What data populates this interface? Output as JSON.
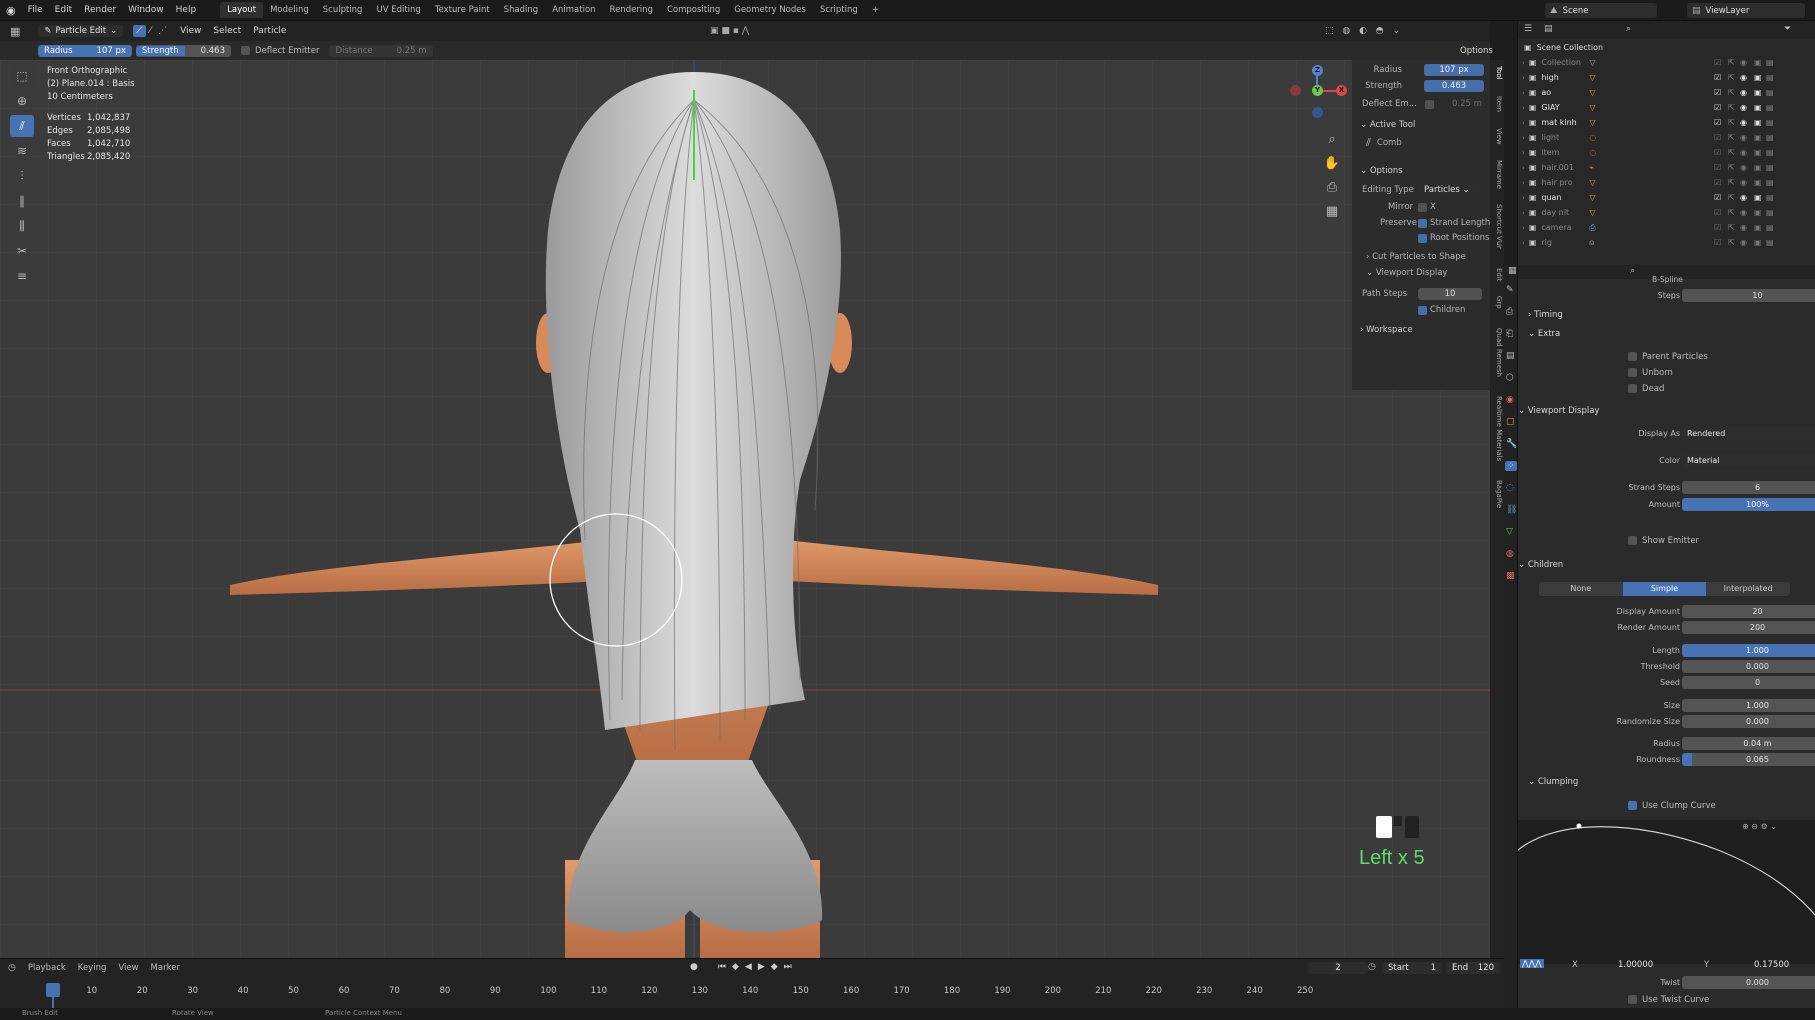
{
  "menus": [
    "File",
    "Edit",
    "Render",
    "Window",
    "Help"
  ],
  "workspaces": [
    "Layout",
    "Modeling",
    "Sculpting",
    "UV Editing",
    "Texture Paint",
    "Shading",
    "Animation",
    "Rendering",
    "Compositing",
    "Geometry Nodes",
    "Scripting"
  ],
  "active_workspace": "Layout",
  "scene_name": "Scene",
  "view_layer": "ViewLayer",
  "header": {
    "mode": "Particle Edit",
    "view": "View",
    "select": "Select",
    "particle": "Particle"
  },
  "tool_header": {
    "radius_label": "Radius",
    "radius_value": "107 px",
    "strength_label": "Strength",
    "strength_value": "0.463",
    "deflect_label": "Deflect Emitter",
    "distance_label": "Distance",
    "distance_value": "0.25 m",
    "options_label": "Options"
  },
  "viewport_info": {
    "view": "Front Orthographic",
    "object": "(2) Plane.014 : Basis",
    "scale": "10 Centimeters",
    "stats": [
      {
        "label": "Vertices",
        "value": "1,042,837"
      },
      {
        "label": "Edges",
        "value": "2,085,498"
      },
      {
        "label": "Faces",
        "value": "1,042,710"
      },
      {
        "label": "Triangles",
        "value": "2,085,420"
      }
    ]
  },
  "key_overlay": "Left x 5",
  "npanel": {
    "radius_label": "Radius",
    "radius_value": "107 px",
    "strength_label": "Strength",
    "strength_value": "0.463",
    "deflect_label": "Deflect Em...",
    "deflect_value": "0.25 m",
    "active_tool": "Active Tool",
    "tool_name": "Comb",
    "options": "Options",
    "editing_type_label": "Editing Type",
    "editing_type_value": "Particles",
    "mirror_label": "Mirror",
    "mirror_value": "X",
    "preserve_label": "Preserve",
    "strand_lengths": "Strand Lengths",
    "root_positions": "Root Positions",
    "cut_particles": "Cut Particles to Shape",
    "viewport_display": "Viewport Display",
    "path_steps_label": "Path Steps",
    "path_steps_value": "10",
    "children": "Children",
    "workspace": "Workspace"
  },
  "side_tabs": [
    "Tool",
    "Item",
    "View",
    "Mirrame",
    "Shortcut VUr",
    "Edit",
    "Quad Remesh",
    "Realtime Materials",
    "Grp",
    "BagaPie"
  ],
  "outliner": {
    "root": "Scene Collection",
    "items": [
      {
        "name": "Collection 12",
        "dim": true
      },
      {
        "name": "high",
        "dim": false
      },
      {
        "name": "ao",
        "dim": false
      },
      {
        "name": "GIAY",
        "dim": false
      },
      {
        "name": "mat kinh",
        "dim": false
      },
      {
        "name": "light",
        "dim": true
      },
      {
        "name": "item",
        "dim": true
      },
      {
        "name": "hair.001",
        "dim": true
      },
      {
        "name": "hair pro",
        "dim": true
      },
      {
        "name": "quan",
        "dim": false
      },
      {
        "name": "day nit",
        "dim": true
      },
      {
        "name": "camera",
        "dim": true
      },
      {
        "name": "rig",
        "dim": true
      }
    ]
  },
  "props": {
    "bspline": "B-Spline",
    "steps_label": "Steps",
    "steps_value": "10",
    "timing": "Timing",
    "extra": "Extra",
    "parent_particles": "Parent Particles",
    "unborn": "Unborn",
    "dead": "Dead",
    "viewport_display": "Viewport Display",
    "display_as_label": "Display As",
    "display_as_value": "Rendered",
    "color_label": "Color",
    "color_value": "Material",
    "strand_steps_label": "Strand Steps",
    "strand_steps_value": "6",
    "amount_label": "Amount",
    "amount_value": "100%",
    "show_emitter": "Show Emitter",
    "children": "Children",
    "child_modes": [
      "None",
      "Simple",
      "Interpolated"
    ],
    "display_amount_label": "Display Amount",
    "display_amount_value": "20",
    "render_amount_label": "Render Amount",
    "render_amount_value": "200",
    "length_label": "Length",
    "length_value": "1.000",
    "threshold_label": "Threshold",
    "threshold_value": "0.000",
    "seed_label": "Seed",
    "seed_value": "0",
    "size_label": "Size",
    "size_value": "1.000",
    "randomize_size_label": "Randomize Size",
    "randomize_size_value": "0.000",
    "radius_label": "Radius",
    "radius_value": "0.04 m",
    "roundness_label": "Roundness",
    "roundness_value": "0.065",
    "clumping": "Clumping",
    "use_clump_curve": "Use Clump Curve",
    "curve_x_label": "X",
    "curve_x_value": "1.00000",
    "curve_y_label": "Y",
    "curve_y_value": "0.17500",
    "twist_label": "Twist",
    "twist_value": "0.000",
    "use_twist_curve": "Use Twist Curve"
  },
  "timeline": {
    "playback": "Playback",
    "keying": "Keying",
    "view": "View",
    "marker": "Marker",
    "current_frame": "2",
    "start_label": "Start",
    "start_value": "1",
    "end_label": "End",
    "end_value": "120",
    "ticks": [
      "2",
      "10",
      "20",
      "30",
      "40",
      "50",
      "60",
      "70",
      "80",
      "90",
      "100",
      "110",
      "120",
      "130",
      "140",
      "150",
      "160",
      "170",
      "180",
      "190",
      "200",
      "210",
      "220",
      "230",
      "240",
      "250"
    ]
  },
  "status": {
    "left": "Brush Edit",
    "middle": "Rotate View",
    "right": "Particle Context Menu"
  },
  "colors": {
    "accent": "#4772b3",
    "viewport": "#3b3b3b",
    "panel": "#2b2b2b",
    "key_overlay": "#5fdc6a",
    "skin": "#d98a5a",
    "hair": "#c9c9c9",
    "shorts": "#a6a6a6"
  }
}
